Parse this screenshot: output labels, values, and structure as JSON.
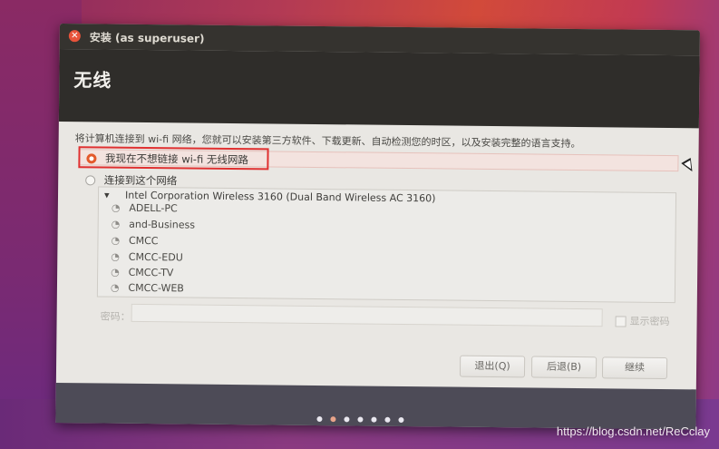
{
  "window": {
    "title": "安装 (as superuser)"
  },
  "header": {
    "title": "无线"
  },
  "intro_text": "将计算机连接到 wi-fi 网络，您就可以安装第三方软件、下载更新、自动检测您的时区，以及安装完整的语言支持。",
  "options": {
    "no_wifi": "我现在不想链接 wi-fi 无线网路",
    "connect": "连接到这个网络"
  },
  "network_list": {
    "adapter": "Intel Corporation Wireless 3160 (Dual Band Wireless AC 3160)",
    "networks": [
      "ADELL-PC",
      "and-Business",
      "CMCC",
      "CMCC-EDU",
      "CMCC-TV",
      "CMCC-WEB"
    ]
  },
  "password": {
    "label": "密码：",
    "show_label": "显示密码"
  },
  "buttons": {
    "quit": "退出(Q)",
    "back": "后退(B)",
    "continue": "继续"
  },
  "progress": {
    "total_steps": 7,
    "current_step": 2
  },
  "watermark": "https://blog.csdn.net/ReCclay",
  "colors": {
    "accent": "#e35a2c",
    "highlight_border": "#e03030",
    "header_bg": "#2f2d2a"
  }
}
